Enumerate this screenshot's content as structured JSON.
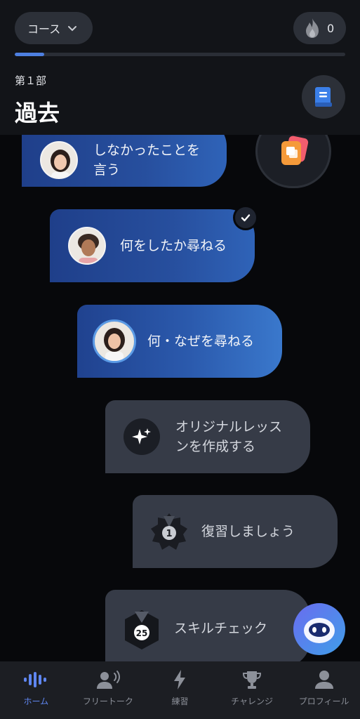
{
  "header": {
    "course_label": "コース",
    "streak_count": "0",
    "progress": 0.09,
    "part_label": "第１部",
    "section_title": "過去"
  },
  "lessons": [
    {
      "label_line1": "しなかったことを",
      "label_line2": "言う",
      "style": "blue"
    },
    {
      "label": "何をしたか尋ねる",
      "style": "blue",
      "completed": true
    },
    {
      "label": "何・なぜを尋ねる",
      "style": "blue",
      "current": true
    },
    {
      "label_line1": "オリジナルレッス",
      "label_line2": "ンを作成する",
      "style": "gray",
      "icon": "sparkle-icon"
    },
    {
      "label": "復習しましょう",
      "style": "gray",
      "icon": "medal-badge-icon",
      "badge_number": "1"
    },
    {
      "label": "スキルチェック",
      "style": "gray",
      "icon": "hex-badge-icon",
      "badge_number": "25"
    }
  ],
  "tabs": [
    {
      "label": "ホーム",
      "icon": "waveform-icon",
      "active": true
    },
    {
      "label": "フリートーク",
      "icon": "speaking-person-icon",
      "active": false
    },
    {
      "label": "練習",
      "icon": "lightning-icon",
      "active": false
    },
    {
      "label": "チャレンジ",
      "icon": "trophy-icon",
      "active": false
    },
    {
      "label": "プロフィール",
      "icon": "person-icon",
      "active": false
    }
  ],
  "colors": {
    "background": "#07080b",
    "accent": "#5f86f0",
    "bubble_blue": "#274f9e",
    "bubble_gray": "#363b47"
  }
}
